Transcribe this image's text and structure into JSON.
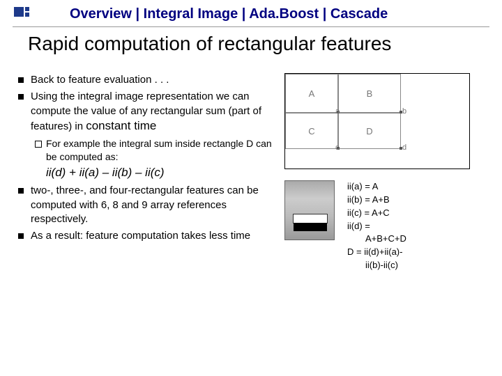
{
  "header": {
    "breadcrumb": "Overview | Integral Image | Ada.Boost | Cascade"
  },
  "title": "Rapid computation of rectangular features",
  "bullets": {
    "b1": "Back to feature evaluation . . .",
    "b2a": "Using the integral image representation we can  compute the value of any rectangular sum (part of features) in ",
    "b2b": "constant time",
    "sub1": "For example the integral sum inside rectangle D can be computed as:",
    "b3": "two-, three-, and four-rectangular features can be computed with 6, 8 and 9 array references respectively.",
    "b4": "As a result: feature computation takes less time"
  },
  "formula": {
    "text": "ii(d) + ii(a) – ii(b) – ii(c)"
  },
  "diagram": {
    "A": "A",
    "B": "B",
    "C": "C",
    "D": "D",
    "a": "a",
    "b": "b",
    "c": "c",
    "d": "d"
  },
  "eqs": {
    "e1": "ii(a) = A",
    "e2": "ii(b) = A+B",
    "e3": "ii(c) = A+C",
    "e4": "ii(d) =",
    "e4b": "A+B+C+D",
    "e5": "D = ii(d)+ii(a)-",
    "e5b": "ii(b)-ii(c)"
  }
}
